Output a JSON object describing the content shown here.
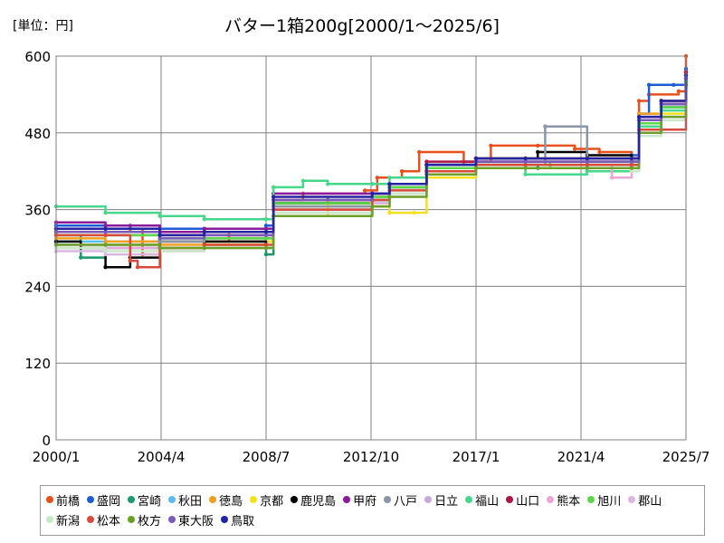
{
  "unit_label": "[単位：円]",
  "chart_data": {
    "type": "line",
    "title": "バター1箱200g[2000/1～2025/6]",
    "ylabel_unit": "[単位：円]",
    "x_tick_labels": [
      "2000/1",
      "2004/4",
      "2008/7",
      "2012/10",
      "2017/1",
      "2021/4",
      "2025/7"
    ],
    "x_ticks_decimal_year": [
      2000.0,
      2004.25,
      2008.5,
      2012.75,
      2017.0,
      2021.25,
      2025.5
    ],
    "xlim": [
      2000.0,
      2025.5
    ],
    "y_ticks": [
      0,
      120,
      240,
      360,
      480,
      600
    ],
    "ylim": [
      0,
      600
    ],
    "grid": "horizontal",
    "legend_position": "bottom",
    "series": [
      {
        "name": "前橋",
        "color": "#e8501e",
        "x": [
          2000.0,
          2003.0,
          2003.5,
          2004.2,
          2006.0,
          2007.0,
          2008.5,
          2008.8,
          2010.0,
          2012.5,
          2013.0,
          2014.0,
          2014.7,
          2016.5,
          2017.6,
          2019.5,
          2021.0,
          2022.0,
          2023.3,
          2023.6,
          2024.0,
          2025.2,
          2025.5
        ],
        "y": [
          325,
          330,
          290,
          310,
          310,
          320,
          325,
          375,
          385,
          390,
          410,
          420,
          450,
          435,
          460,
          460,
          455,
          450,
          440,
          530,
          540,
          545,
          600
        ]
      },
      {
        "name": "盛岡",
        "color": "#1e5bd6",
        "x": [
          2000.0,
          2003.0,
          2004.2,
          2006.0,
          2008.5,
          2008.8,
          2011.0,
          2012.8,
          2013.5,
          2015.0,
          2017.0,
          2019.0,
          2021.5,
          2023.3,
          2023.6,
          2024.0,
          2025.0,
          2025.5
        ],
        "y": [
          335,
          335,
          330,
          330,
          335,
          370,
          375,
          380,
          400,
          430,
          440,
          440,
          440,
          445,
          510,
          555,
          555,
          580
        ]
      },
      {
        "name": "宮崎",
        "color": "#1a9a6c",
        "x": [
          2000.0,
          2001.0,
          2002.0,
          2004.2,
          2006.0,
          2008.5,
          2008.8,
          2012.8,
          2013.5,
          2015.0,
          2017.0,
          2019.5,
          2021.5,
          2023.3,
          2023.6,
          2024.5,
          2025.5
        ],
        "y": [
          320,
          285,
          300,
          300,
          305,
          290,
          365,
          375,
          395,
          420,
          430,
          425,
          430,
          435,
          500,
          520,
          560
        ]
      },
      {
        "name": "秋田",
        "color": "#5bbcf0",
        "x": [
          2000.0,
          2002.0,
          2004.2,
          2006.0,
          2008.5,
          2008.8,
          2012.8,
          2013.5,
          2015.0,
          2017.0,
          2019.0,
          2021.5,
          2023.3,
          2023.6,
          2024.5,
          2025.5
        ],
        "y": [
          310,
          310,
          300,
          300,
          300,
          360,
          380,
          395,
          425,
          435,
          430,
          430,
          425,
          490,
          520,
          560
        ]
      },
      {
        "name": "徳島",
        "color": "#f0a020",
        "x": [
          2000.0,
          2002.0,
          2004.2,
          2006.0,
          2008.5,
          2008.8,
          2012.8,
          2013.5,
          2015.0,
          2017.0,
          2019.0,
          2021.5,
          2023.3,
          2023.6,
          2024.5,
          2025.5
        ],
        "y": [
          315,
          310,
          305,
          310,
          310,
          365,
          380,
          395,
          430,
          440,
          440,
          440,
          440,
          510,
          530,
          570
        ]
      },
      {
        "name": "京都",
        "color": "#f5e020",
        "x": [
          2000.0,
          2002.0,
          2004.2,
          2006.0,
          2008.5,
          2008.8,
          2011.0,
          2012.8,
          2013.5,
          2014.5,
          2015.0,
          2017.0,
          2019.0,
          2021.5,
          2023.3,
          2023.6,
          2024.5,
          2025.5
        ],
        "y": [
          300,
          305,
          300,
          305,
          310,
          350,
          370,
          365,
          355,
          355,
          410,
          425,
          425,
          420,
          420,
          480,
          510,
          560
        ]
      },
      {
        "name": "鹿児島",
        "color": "#000000",
        "x": [
          2000.0,
          2001.0,
          2002.0,
          2003.0,
          2004.2,
          2006.0,
          2008.5,
          2008.8,
          2012.8,
          2013.5,
          2015.0,
          2017.0,
          2019.5,
          2021.5,
          2023.3,
          2023.6,
          2024.5,
          2025.5
        ],
        "y": [
          310,
          300,
          270,
          285,
          310,
          310,
          300,
          370,
          375,
          395,
          420,
          440,
          450,
          445,
          440,
          500,
          525,
          575
        ]
      },
      {
        "name": "甲府",
        "color": "#8a1a9a",
        "x": [
          2000.0,
          2002.0,
          2004.2,
          2006.0,
          2008.5,
          2008.8,
          2012.8,
          2013.5,
          2015.0,
          2017.0,
          2019.0,
          2021.5,
          2023.3,
          2023.6,
          2024.5,
          2025.5
        ],
        "y": [
          340,
          335,
          325,
          330,
          330,
          385,
          385,
          400,
          430,
          435,
          435,
          435,
          430,
          495,
          525,
          565
        ]
      },
      {
        "name": "八戸",
        "color": "#8a96a8",
        "x": [
          2000.0,
          2002.0,
          2004.2,
          2006.0,
          2008.5,
          2008.8,
          2012.8,
          2013.5,
          2015.0,
          2017.0,
          2019.0,
          2019.8,
          2021.5,
          2023.3,
          2023.6,
          2024.5,
          2025.5
        ],
        "y": [
          320,
          320,
          310,
          315,
          315,
          365,
          375,
          395,
          425,
          430,
          430,
          490,
          440,
          435,
          500,
          520,
          560
        ]
      },
      {
        "name": "日立",
        "color": "#c8a8d8",
        "x": [
          2000.0,
          2002.0,
          2004.2,
          2006.0,
          2008.5,
          2008.8,
          2012.8,
          2013.5,
          2015.0,
          2017.0,
          2019.0,
          2021.5,
          2023.3,
          2023.6,
          2024.5,
          2025.5
        ],
        "y": [
          305,
          305,
          300,
          300,
          300,
          360,
          370,
          385,
          415,
          430,
          425,
          425,
          420,
          480,
          505,
          555
        ]
      },
      {
        "name": "福山",
        "color": "#46d68c",
        "x": [
          2000.0,
          2002.0,
          2004.2,
          2006.0,
          2008.5,
          2008.8,
          2010.0,
          2011.0,
          2012.8,
          2013.5,
          2015.0,
          2017.0,
          2019.0,
          2021.5,
          2023.3,
          2023.6,
          2024.5,
          2025.5
        ],
        "y": [
          365,
          355,
          350,
          345,
          345,
          395,
          405,
          400,
          400,
          410,
          430,
          430,
          415,
          420,
          425,
          490,
          515,
          560
        ]
      },
      {
        "name": "山口",
        "color": "#b0144a",
        "x": [
          2000.0,
          2002.0,
          2004.2,
          2006.0,
          2008.5,
          2008.8,
          2012.8,
          2013.5,
          2015.0,
          2017.0,
          2019.0,
          2021.5,
          2023.3,
          2023.6,
          2024.5,
          2025.5
        ],
        "y": [
          330,
          330,
          320,
          320,
          320,
          375,
          385,
          400,
          435,
          440,
          440,
          440,
          440,
          505,
          530,
          575
        ]
      },
      {
        "name": "熊本",
        "color": "#e8a8d8",
        "x": [
          2000.0,
          2002.0,
          2004.2,
          2006.0,
          2008.5,
          2008.8,
          2012.8,
          2013.5,
          2015.0,
          2017.0,
          2019.0,
          2021.5,
          2022.5,
          2023.3,
          2023.6,
          2024.5,
          2025.5
        ],
        "y": [
          300,
          300,
          295,
          300,
          300,
          355,
          370,
          385,
          420,
          430,
          425,
          430,
          410,
          420,
          480,
          505,
          550
        ]
      },
      {
        "name": "旭川",
        "color": "#5ad84a",
        "x": [
          2000.0,
          2002.0,
          2004.2,
          2006.0,
          2008.5,
          2008.8,
          2012.8,
          2013.5,
          2015.0,
          2017.0,
          2019.0,
          2020.0,
          2021.5,
          2023.3,
          2023.6,
          2024.5,
          2025.5
        ],
        "y": [
          320,
          320,
          315,
          315,
          315,
          370,
          380,
          395,
          425,
          430,
          430,
          430,
          435,
          435,
          495,
          520,
          560
        ]
      },
      {
        "name": "郡山",
        "color": "#d8b8e0",
        "x": [
          2000.0,
          2002.0,
          2004.2,
          2006.0,
          2008.5,
          2008.8,
          2012.8,
          2013.5,
          2015.0,
          2017.0,
          2019.0,
          2021.5,
          2023.3,
          2023.6,
          2024.5,
          2025.5
        ],
        "y": [
          295,
          290,
          300,
          300,
          300,
          355,
          370,
          385,
          415,
          425,
          425,
          425,
          420,
          480,
          500,
          550
        ]
      },
      {
        "name": "新潟",
        "color": "#c8e8c8",
        "x": [
          2000.0,
          2002.0,
          2004.2,
          2006.0,
          2008.5,
          2008.8,
          2012.8,
          2013.5,
          2015.0,
          2017.0,
          2019.0,
          2021.5,
          2023.3,
          2023.6,
          2024.5,
          2025.5
        ],
        "y": [
          300,
          295,
          295,
          300,
          300,
          355,
          365,
          385,
          415,
          425,
          425,
          425,
          420,
          475,
          500,
          550
        ]
      },
      {
        "name": "松本",
        "color": "#d84a3a",
        "x": [
          2000.0,
          2002.0,
          2003.0,
          2003.3,
          2004.2,
          2006.0,
          2008.5,
          2008.8,
          2012.8,
          2013.5,
          2015.0,
          2017.0,
          2019.0,
          2021.5,
          2023.3,
          2023.6,
          2024.5,
          2025.5
        ],
        "y": [
          320,
          320,
          280,
          270,
          300,
          305,
          305,
          360,
          375,
          390,
          420,
          430,
          430,
          430,
          430,
          485,
          485,
          555
        ]
      },
      {
        "name": "枚方",
        "color": "#6aa028",
        "x": [
          2000.0,
          2002.0,
          2004.2,
          2006.0,
          2008.5,
          2008.8,
          2012.8,
          2013.5,
          2015.0,
          2017.0,
          2019.0,
          2021.5,
          2023.3,
          2023.6,
          2024.5,
          2025.5
        ],
        "y": [
          305,
          305,
          300,
          300,
          300,
          350,
          365,
          380,
          415,
          425,
          425,
          425,
          425,
          480,
          505,
          555
        ]
      },
      {
        "name": "東大阪",
        "color": "#7a5ab8",
        "x": [
          2000.0,
          2002.0,
          2004.2,
          2006.0,
          2008.5,
          2008.8,
          2012.8,
          2013.5,
          2015.0,
          2017.0,
          2019.0,
          2021.5,
          2023.3,
          2023.6,
          2024.5,
          2025.5
        ],
        "y": [
          325,
          325,
          315,
          320,
          320,
          375,
          385,
          400,
          430,
          435,
          435,
          435,
          435,
          500,
          525,
          565
        ]
      },
      {
        "name": "鳥取",
        "color": "#2424a0",
        "x": [
          2000.0,
          2002.0,
          2004.2,
          2006.0,
          2008.5,
          2008.8,
          2012.8,
          2013.5,
          2015.0,
          2017.0,
          2019.0,
          2021.5,
          2023.3,
          2023.6,
          2024.5,
          2025.5
        ],
        "y": [
          330,
          330,
          320,
          325,
          325,
          380,
          385,
          400,
          430,
          440,
          440,
          440,
          440,
          505,
          530,
          570
        ]
      }
    ]
  }
}
